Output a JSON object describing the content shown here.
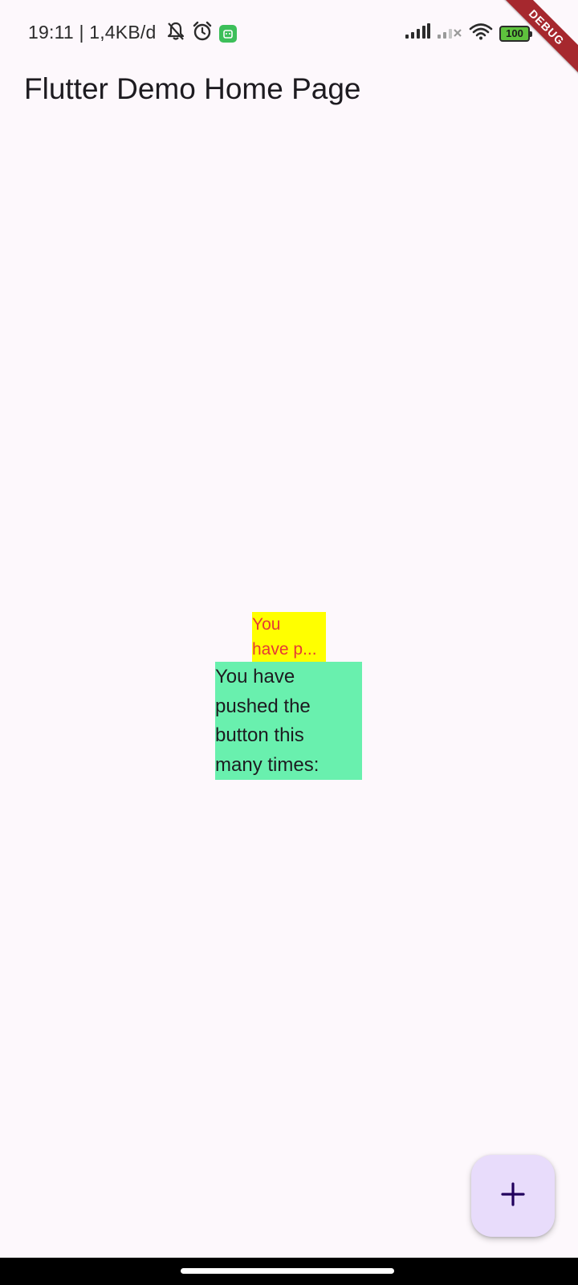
{
  "status_bar": {
    "time_text": "19:11 | 1,4KB/d",
    "icons_left": [
      "bell-off-icon",
      "alarm-icon",
      "app-notification-icon"
    ],
    "icons_right": [
      "signal-icon",
      "signal-weak-icon",
      "wifi-icon",
      "battery-icon"
    ],
    "battery_level": "100"
  },
  "debug_banner": {
    "label": "DEBUG"
  },
  "app_bar": {
    "title": "Flutter Demo Home Page"
  },
  "main": {
    "yellow_text_line1": "You",
    "yellow_text_line2": "have p...",
    "green_text_lines": [
      "You have",
      "pushed the",
      "button this",
      "many times:"
    ]
  },
  "fab": {
    "icon": "add-icon"
  },
  "colors": {
    "background": "#fdf8fc",
    "yellow_box": "#ffff00",
    "yellow_text": "#e53935",
    "green_box": "#69f0ae",
    "fab": "#e8dcfb",
    "debug_banner": "#a6282e"
  }
}
